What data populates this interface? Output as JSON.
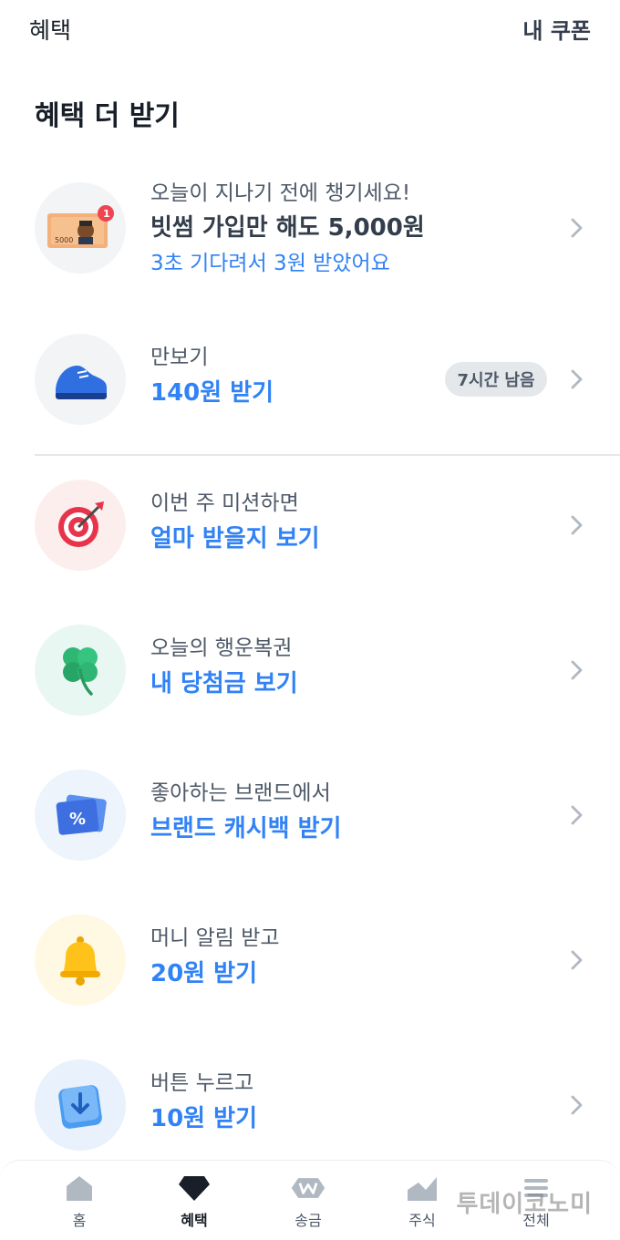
{
  "header": {
    "title": "혜택",
    "coupon_link": "내 쿠폰"
  },
  "section": {
    "title": "혜택 더 받기"
  },
  "items": [
    {
      "sub": "오늘이 지나기 전에 챙기세요!",
      "main": "빗썸 가입만 해도 5,000원",
      "extra": "3초 기다려서 3원 받았어요",
      "icon": "banknote-icon",
      "note_label": "5000",
      "notification_count": "1"
    },
    {
      "sub": "만보기",
      "main": "140원 받기",
      "badge": "7시간 남음",
      "icon": "sneaker-icon"
    },
    {
      "sub": "이번 주 미션하면",
      "main": "얼마 받을지 보기",
      "icon": "target-icon"
    },
    {
      "sub": "오늘의 행운복권",
      "main": "내 당첨금 보기",
      "icon": "clover-icon"
    },
    {
      "sub": "좋아하는 브랜드에서",
      "main": "브랜드 캐시백 받기",
      "icon": "percent-card-icon"
    },
    {
      "sub": "머니 알림 받고",
      "main": "20원 받기",
      "icon": "bell-icon"
    },
    {
      "sub": "버튼 누르고",
      "main": "10원 받기",
      "icon": "down-arrow-button-icon"
    }
  ],
  "tabbar": {
    "tabs": [
      {
        "label": "홈",
        "icon": "home-icon"
      },
      {
        "label": "혜택",
        "icon": "diamond-icon",
        "active": true
      },
      {
        "label": "송금",
        "icon": "won-transfer-icon"
      },
      {
        "label": "주식",
        "icon": "stock-chart-icon"
      },
      {
        "label": "전체",
        "icon": "menu-icon"
      }
    ]
  },
  "watermark": "투데이코노미",
  "colors": {
    "accent": "#3182f6",
    "text": "#191f28",
    "subtext": "#4e5968"
  }
}
